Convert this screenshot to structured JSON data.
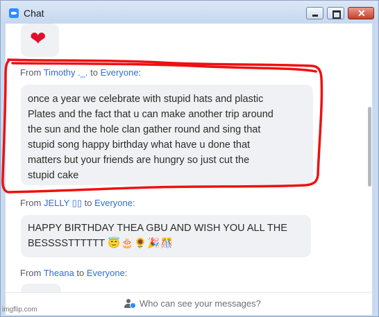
{
  "window": {
    "title": "Chat",
    "min_glyph": "",
    "close_glyph": "✕"
  },
  "messages": [
    {
      "emoji": "❤"
    },
    {
      "from_prefix": "From ",
      "sender": "Timothy ._.",
      "to_word": " to ",
      "recipient": "Everyone",
      "suffix": ":",
      "lines": [
        "once a year we celebrate with stupid hats and plastic",
        "Plates and the fact that u can make another trip around",
        "the sun and the hole clan gather round and sing that",
        "stupid song happy birthday what have u done that",
        "matters but your friends are hungry so just cut the",
        "stupid cake"
      ]
    },
    {
      "from_prefix": "From ",
      "sender": "JELLY ▯▯",
      "to_word": " to ",
      "recipient": "Everyone",
      "suffix": ":",
      "line1": "HAPPY BIRTHDAY THEA GBU AND WISH YOU ALL THE",
      "line2": "BESSSSTTTTTT ",
      "emojis": "😇🎂🌻🎉🎊"
    },
    {
      "from_prefix": "From ",
      "sender": "Theana",
      "to_word": " to ",
      "recipient": "Everyone",
      "suffix": ":"
    }
  ],
  "footer": {
    "icon": "person-question-icon",
    "text": "Who can see your messages?"
  },
  "annotation": {
    "color": "#ee1111"
  },
  "watermark": "imgflip.com"
}
